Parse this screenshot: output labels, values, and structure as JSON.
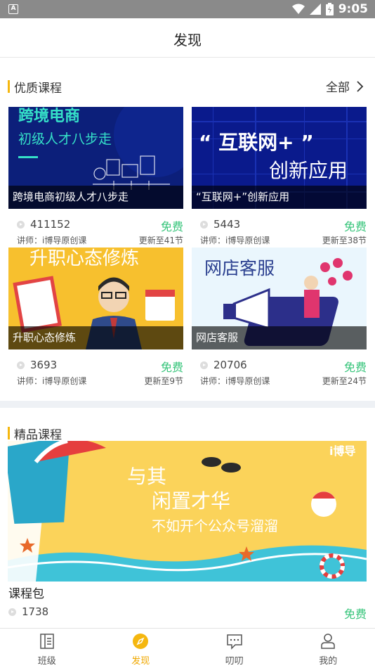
{
  "status_bar": {
    "time": "9:05",
    "left_icon": "A"
  },
  "header": {
    "title": "发现"
  },
  "quality_section": {
    "title": "优质课程",
    "more_label": "全部"
  },
  "quality_courses": [
    {
      "caption": "跨境电商初级人才八步走",
      "views": "411152",
      "price": "免费",
      "teacher": "讲师：i博导原创课",
      "update": "更新至41节",
      "thumb": {
        "line1": "跨境电商",
        "line2": "初级人才八步走",
        "bg": "#0c1f7a"
      }
    },
    {
      "caption": "“互联网+”创新应用",
      "views": "5443",
      "price": "免费",
      "teacher": "讲师：i博导原创课",
      "update": "更新至38节",
      "thumb": {
        "line1": "“ 互联网+ ”",
        "line2": "创新应用",
        "bg": "#0a1a8c"
      }
    },
    {
      "caption": "升职心态修炼",
      "views": "3693",
      "price": "免费",
      "teacher": "讲师：i博导原创课",
      "update": "更新至9节",
      "thumb": {
        "line1": "升职心态修炼",
        "bg": "#f7c02e"
      }
    },
    {
      "caption": "网店客服",
      "views": "20706",
      "price": "免费",
      "teacher": "讲师：i博导原创课",
      "update": "更新至24节",
      "thumb": {
        "line1": "网店客服",
        "bg": "#eaf6fd"
      }
    }
  ],
  "premium_section": {
    "title": "精品课程"
  },
  "premium_package": {
    "banner": {
      "line1": "与其",
      "line2": "闲置才华",
      "line3": "不如开个公众号溜溜",
      "brand": "i博导",
      "bg": "#fbd35a"
    },
    "title": "课程包",
    "views": "1738",
    "price": "免费"
  },
  "tabs": [
    {
      "label": "班级",
      "icon": "class-icon",
      "active": false
    },
    {
      "label": "发现",
      "icon": "compass-icon",
      "active": true
    },
    {
      "label": "叨叨",
      "icon": "chat-icon",
      "active": false
    },
    {
      "label": "我的",
      "icon": "profile-icon",
      "active": false
    }
  ],
  "colors": {
    "accent": "#f5b70f",
    "price_green": "#36c47a",
    "divider": "#eef1f5"
  }
}
